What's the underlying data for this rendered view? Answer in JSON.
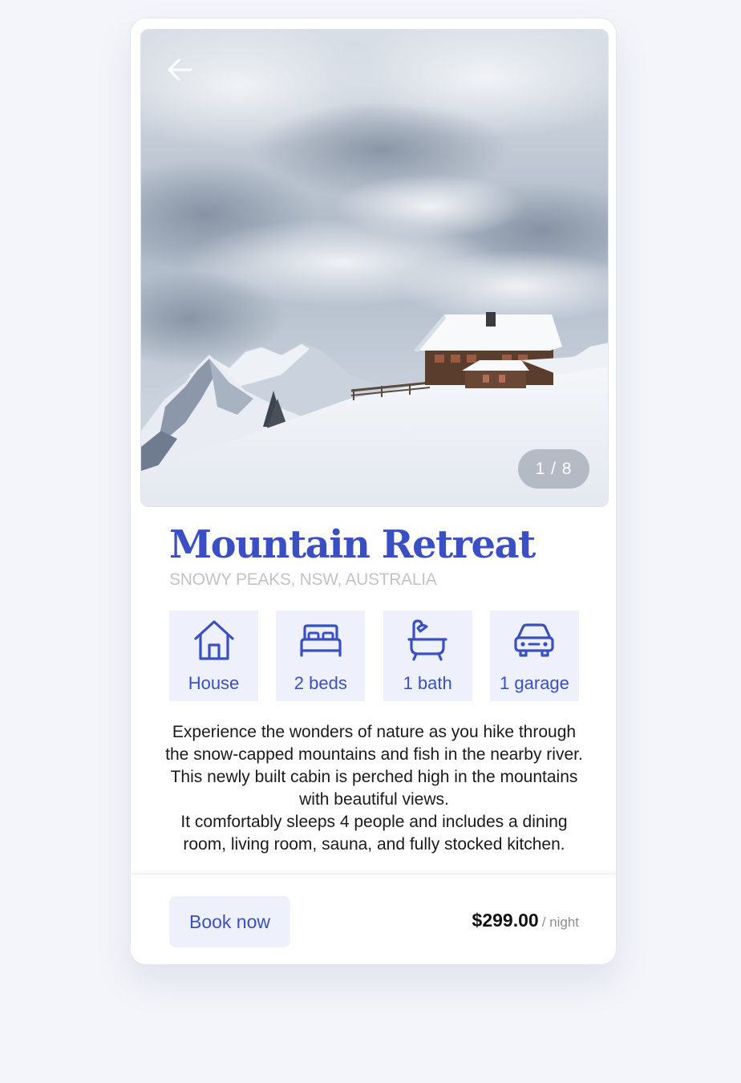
{
  "listing": {
    "title": "Mountain Retreat",
    "location": "SNOWY PEAKS, NSW, AUSTRALIA",
    "image_counter": "1 / 8",
    "features": [
      {
        "icon": "house-icon",
        "label": "House"
      },
      {
        "icon": "bed-icon",
        "label": "2 beds"
      },
      {
        "icon": "bathtub-icon",
        "label": "1 bath"
      },
      {
        "icon": "car-icon",
        "label": "1 garage"
      }
    ],
    "description": [
      "Experience the wonders of nature as you hike through the snow-capped mountains and fish in the nearby river. This newly built cabin is perched high in the mountains with beautiful views.",
      "It comfortably sleeps 4 people and includes a dining room, living room, sauna, and fully stocked kitchen."
    ]
  },
  "footer": {
    "book_label": "Book now",
    "price": "$299.00",
    "price_unit": "/ night"
  },
  "colors": {
    "accent": "#3b4fc4",
    "chip_background": "#eef1fb",
    "page_background": "#f3f5fa"
  }
}
